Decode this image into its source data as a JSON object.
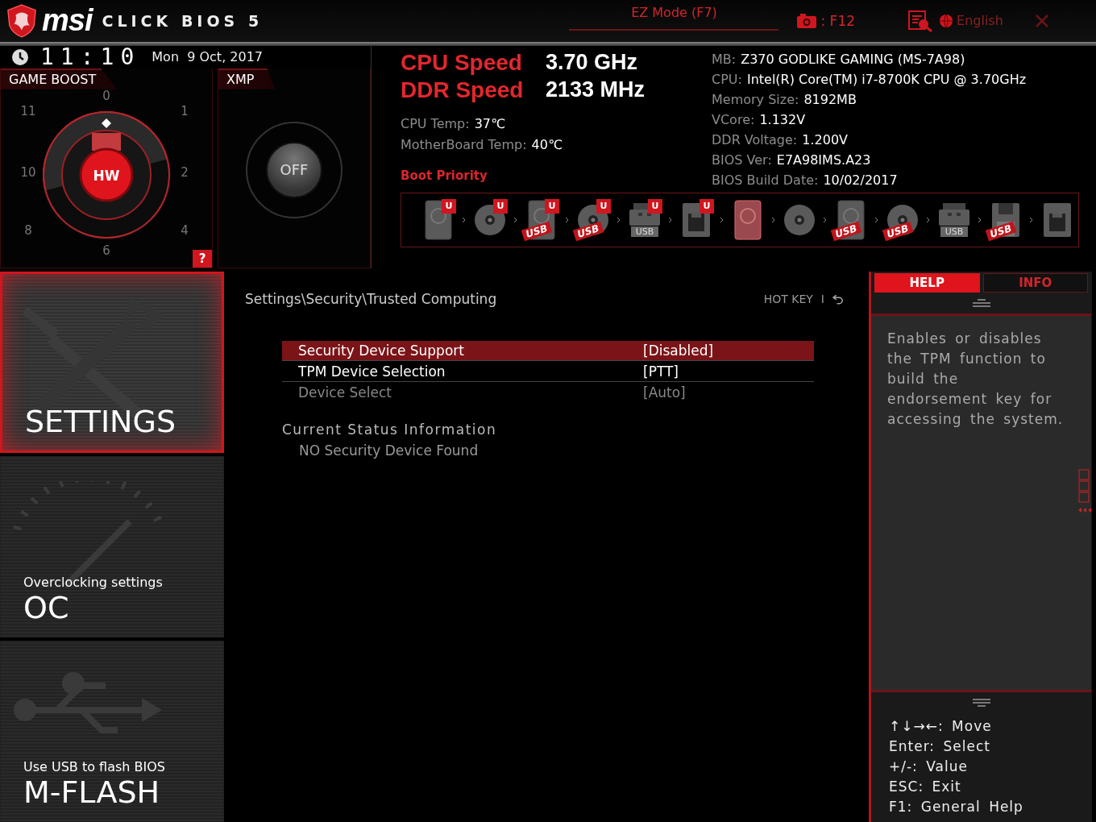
{
  "header": {
    "brand": "msi",
    "product": "CLICK BIOS 5",
    "ez_mode": "EZ Mode (F7)",
    "screenshot_key": ": F12",
    "language": "English"
  },
  "clock": {
    "time": "11:10",
    "date": "Mon  9 Oct, 2017"
  },
  "game_boost": {
    "title": "GAME BOOST",
    "dial_labels": [
      "0",
      "11",
      "1",
      "10",
      "2",
      "8",
      "4",
      "6"
    ],
    "center": "HW",
    "help": "?"
  },
  "xmp": {
    "title": "XMP",
    "button": "OFF",
    "on": false
  },
  "speeds": [
    {
      "label": "CPU Speed",
      "value": "3.70 GHz"
    },
    {
      "label": "DDR Speed",
      "value": "2133 MHz"
    }
  ],
  "temps": [
    {
      "label": "CPU Temp:",
      "value": "37℃"
    },
    {
      "label": "MotherBoard Temp:",
      "value": "40℃"
    }
  ],
  "system_info": [
    {
      "label": "MB:",
      "value": "Z370 GODLIKE GAMING (MS-7A98)"
    },
    {
      "label": "CPU:",
      "value": "Intel(R) Core(TM) i7-8700K CPU @ 3.70GHz"
    },
    {
      "label": "Memory Size:",
      "value": "8192MB"
    },
    {
      "label": "VCore:",
      "value": "1.132V"
    },
    {
      "label": "DDR Voltage:",
      "value": "1.200V"
    },
    {
      "label": "BIOS Ver:",
      "value": "E7A98IMS.A23"
    },
    {
      "label": "BIOS Build Date:",
      "value": "10/02/2017"
    }
  ],
  "boot_priority": {
    "title": "Boot Priority",
    "devices": [
      {
        "kind": "hdd",
        "badge": "U",
        "selected": false
      },
      {
        "kind": "optical",
        "badge": "U",
        "selected": false
      },
      {
        "kind": "hdd",
        "badge": "U",
        "tag": "USB",
        "selected": false
      },
      {
        "kind": "optical",
        "badge": "U",
        "tag": "USB",
        "selected": false
      },
      {
        "kind": "usb-stick",
        "badge": "U",
        "label": "USB",
        "selected": false
      },
      {
        "kind": "network",
        "badge": "U",
        "selected": false
      },
      {
        "kind": "hdd",
        "selected": true
      },
      {
        "kind": "optical",
        "selected": false
      },
      {
        "kind": "hdd",
        "tag": "USB",
        "selected": false
      },
      {
        "kind": "optical",
        "tag": "USB",
        "selected": false
      },
      {
        "kind": "usb-stick",
        "label": "USB",
        "selected": false
      },
      {
        "kind": "floppy",
        "tag": "USB",
        "selected": false
      },
      {
        "kind": "network",
        "selected": false
      }
    ]
  },
  "nav": [
    {
      "kind": "settings",
      "title": "SETTINGS",
      "selected": true
    },
    {
      "kind": "oc",
      "subtitle": "Overclocking settings",
      "title": "OC",
      "selected": false
    },
    {
      "kind": "mflash",
      "subtitle": "Use USB to flash BIOS",
      "title": "M-FLASH",
      "selected": false
    }
  ],
  "content": {
    "breadcrumb": "Settings\\Security\\Trusted Computing",
    "hot_key": "HOT KEY",
    "separator": "I",
    "rows": [
      {
        "label": "Security Device Support",
        "value": "[Disabled]",
        "selected": true,
        "disabled": false
      },
      {
        "label": "TPM Device Selection",
        "value": "[PTT]",
        "selected": false,
        "disabled": false
      },
      {
        "label": "Device Select",
        "value": "[Auto]",
        "selected": false,
        "disabled": true
      }
    ],
    "section": {
      "title": "Current Status Information",
      "lines": [
        "NO Security Device Found"
      ]
    }
  },
  "help": {
    "tabs": [
      {
        "label": "HELP",
        "selected": true
      },
      {
        "label": "INFO",
        "selected": false
      }
    ],
    "text": "Enables or disables the TPM function to build the endorsement key for accessing the system.",
    "keys": [
      "↑↓→←: Move",
      "Enter: Select",
      "+/-: Value",
      "ESC: Exit",
      "F1: General Help"
    ]
  }
}
